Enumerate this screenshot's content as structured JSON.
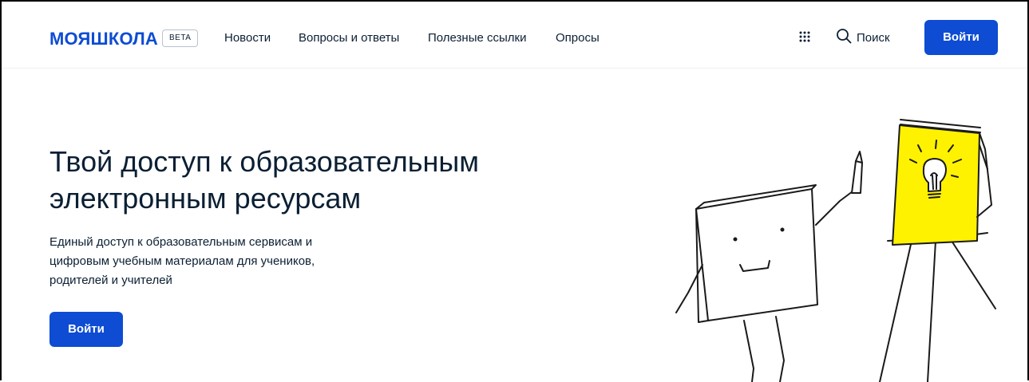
{
  "header": {
    "logo": "МОЯШКОЛА",
    "badge": "BETA",
    "nav": [
      "Новости",
      "Вопросы и ответы",
      "Полезные ссылки",
      "Опросы"
    ],
    "apps_icon": "grid-icon",
    "search_icon": "search-icon",
    "search_label": "Поиск",
    "login_label": "Войти"
  },
  "hero": {
    "title_line1": "Твой доступ к образовательным",
    "title_line2": "электронным ресурсам",
    "text_line1": "Единый доступ к образовательным сервисам и",
    "text_line2": "цифровым учебным материалам для учеников,",
    "text_line3": "родителей и учителей",
    "login_label": "Войти"
  },
  "colors": {
    "brand": "#0d4cd3",
    "text": "#0b1f33",
    "illustration_yellow": "#fff200"
  }
}
